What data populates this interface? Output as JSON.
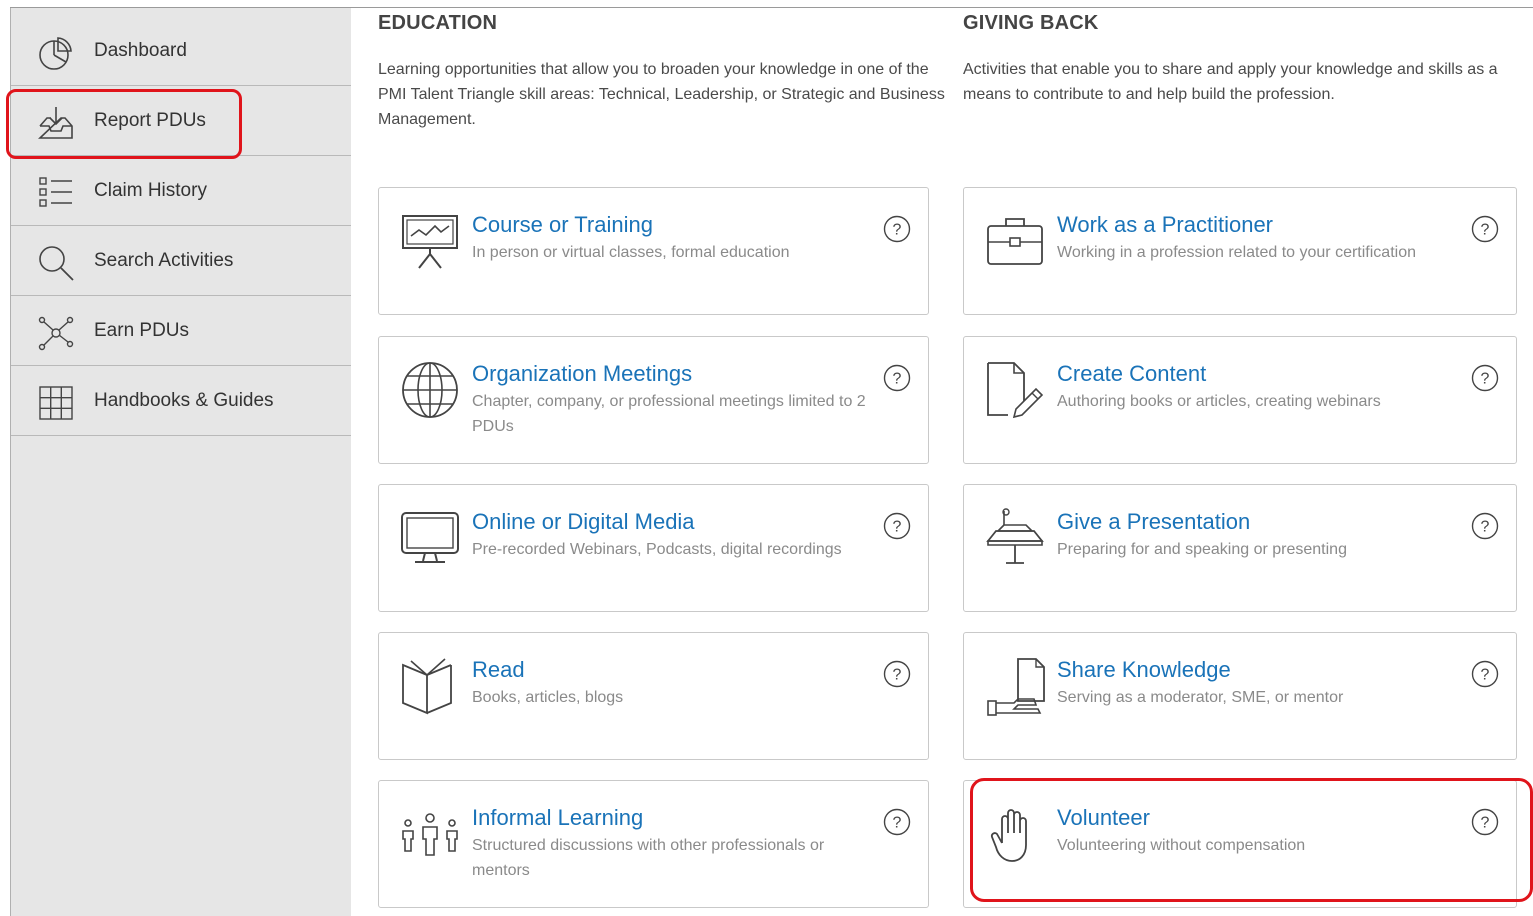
{
  "sidebar": {
    "items": [
      {
        "label": "Dashboard",
        "icon": "pie-chart-icon"
      },
      {
        "label": "Report PDUs",
        "icon": "inbox-upload-icon"
      },
      {
        "label": "Claim History",
        "icon": "list-icon"
      },
      {
        "label": "Search Activities",
        "icon": "search-icon"
      },
      {
        "label": "Earn PDUs",
        "icon": "network-icon"
      },
      {
        "label": "Handbooks & Guides",
        "icon": "grid-icon"
      }
    ]
  },
  "education": {
    "heading": "EDUCATION",
    "description": "Learning opportunities that allow you to broaden your knowledge in one of the PMI Talent Triangle skill areas: Technical, Leadership, or Strategic and Business Management.",
    "cards": [
      {
        "title": "Course or Training",
        "subtitle": "In person or virtual classes, formal education",
        "icon": "presentation-board-icon"
      },
      {
        "title": "Organization Meetings",
        "subtitle": "Chapter, company, or professional meetings limited to 2 PDUs",
        "icon": "globe-icon"
      },
      {
        "title": "Online or Digital Media",
        "subtitle": "Pre-recorded Webinars, Podcasts, digital recordings",
        "icon": "monitor-icon"
      },
      {
        "title": "Read",
        "subtitle": "Books, articles, blogs",
        "icon": "open-book-icon"
      },
      {
        "title": "Informal Learning",
        "subtitle": "Structured discussions with other professionals or mentors",
        "icon": "people-icon"
      }
    ]
  },
  "giving_back": {
    "heading": "GIVING BACK",
    "description": "Activities that enable you to share and apply your knowledge and skills as a means to contribute to and help build the profession.",
    "cards": [
      {
        "title": "Work as a Practitioner",
        "subtitle": "Working in a profession related to your certification",
        "icon": "briefcase-icon"
      },
      {
        "title": "Create Content",
        "subtitle": "Authoring books or articles, creating webinars",
        "icon": "document-pencil-icon"
      },
      {
        "title": "Give a Presentation",
        "subtitle": "Preparing for and speaking or presenting",
        "icon": "podium-icon"
      },
      {
        "title": "Share Knowledge",
        "subtitle": "Serving as a moderator, SME, or mentor",
        "icon": "hand-document-icon"
      },
      {
        "title": "Volunteer",
        "subtitle": "Volunteering without compensation",
        "icon": "raised-hand-icon"
      }
    ]
  },
  "colors": {
    "link": "#1a73b8",
    "highlight": "#e0141b",
    "sidebar_bg": "#e6e6e6"
  }
}
